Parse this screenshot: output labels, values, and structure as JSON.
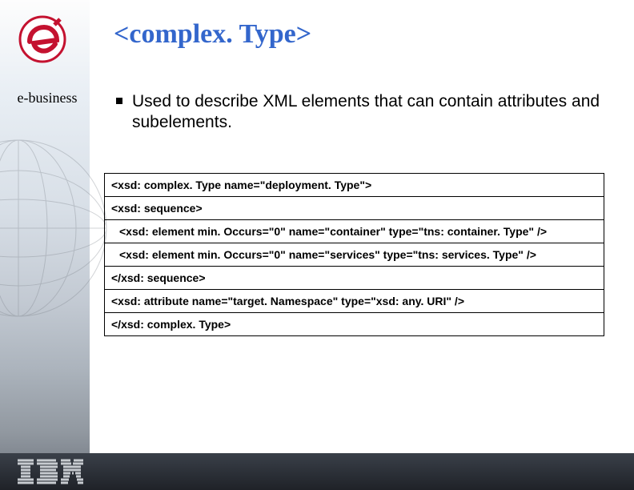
{
  "title": "<complex. Type>",
  "sidebar": {
    "label": "e-business"
  },
  "bullet": "Used to describe XML elements that can contain attributes and subelements.",
  "code": {
    "lines": [
      "<xsd: complex. Type name=\"deployment. Type\">",
      "<xsd: sequence>",
      "<xsd: element min. Occurs=\"0\" name=\"container\" type=\"tns: container. Type\" />",
      "<xsd: element min. Occurs=\"0\" name=\"services\" type=\"tns: services. Type\" />",
      "</xsd: sequence>",
      "<xsd: attribute name=\"target. Namespace\" type=\"xsd: any. URI\" />",
      "</xsd: complex. Type>"
    ],
    "indents": [
      0,
      0,
      1,
      1,
      0,
      0,
      0
    ]
  },
  "logos": {
    "top": "e-business-logo-icon",
    "bottom": "ibm-logo-icon"
  }
}
